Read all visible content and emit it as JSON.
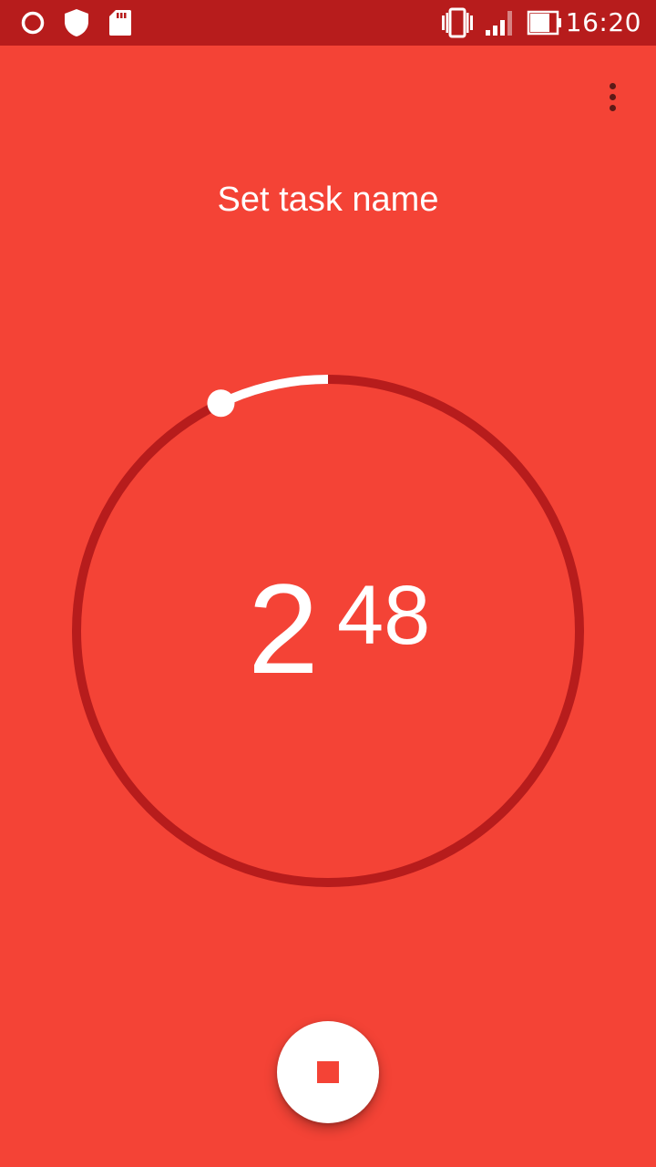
{
  "status_bar": {
    "time": "16:20",
    "icons": [
      "circle-icon",
      "shield-icon",
      "sd-card-icon",
      "vibrate-icon",
      "signal-icon",
      "battery-icon"
    ]
  },
  "colors": {
    "background": "#f44336",
    "status_bar": "#b71c1c",
    "track": "#b71c1c",
    "progress": "#ffffff"
  },
  "menu": {
    "icon": "more-vert-icon"
  },
  "task": {
    "name": "Set task name"
  },
  "timer": {
    "minutes": "2",
    "seconds": "48",
    "progress_fraction": 0.07
  },
  "controls": {
    "stop_icon": "stop-icon"
  }
}
